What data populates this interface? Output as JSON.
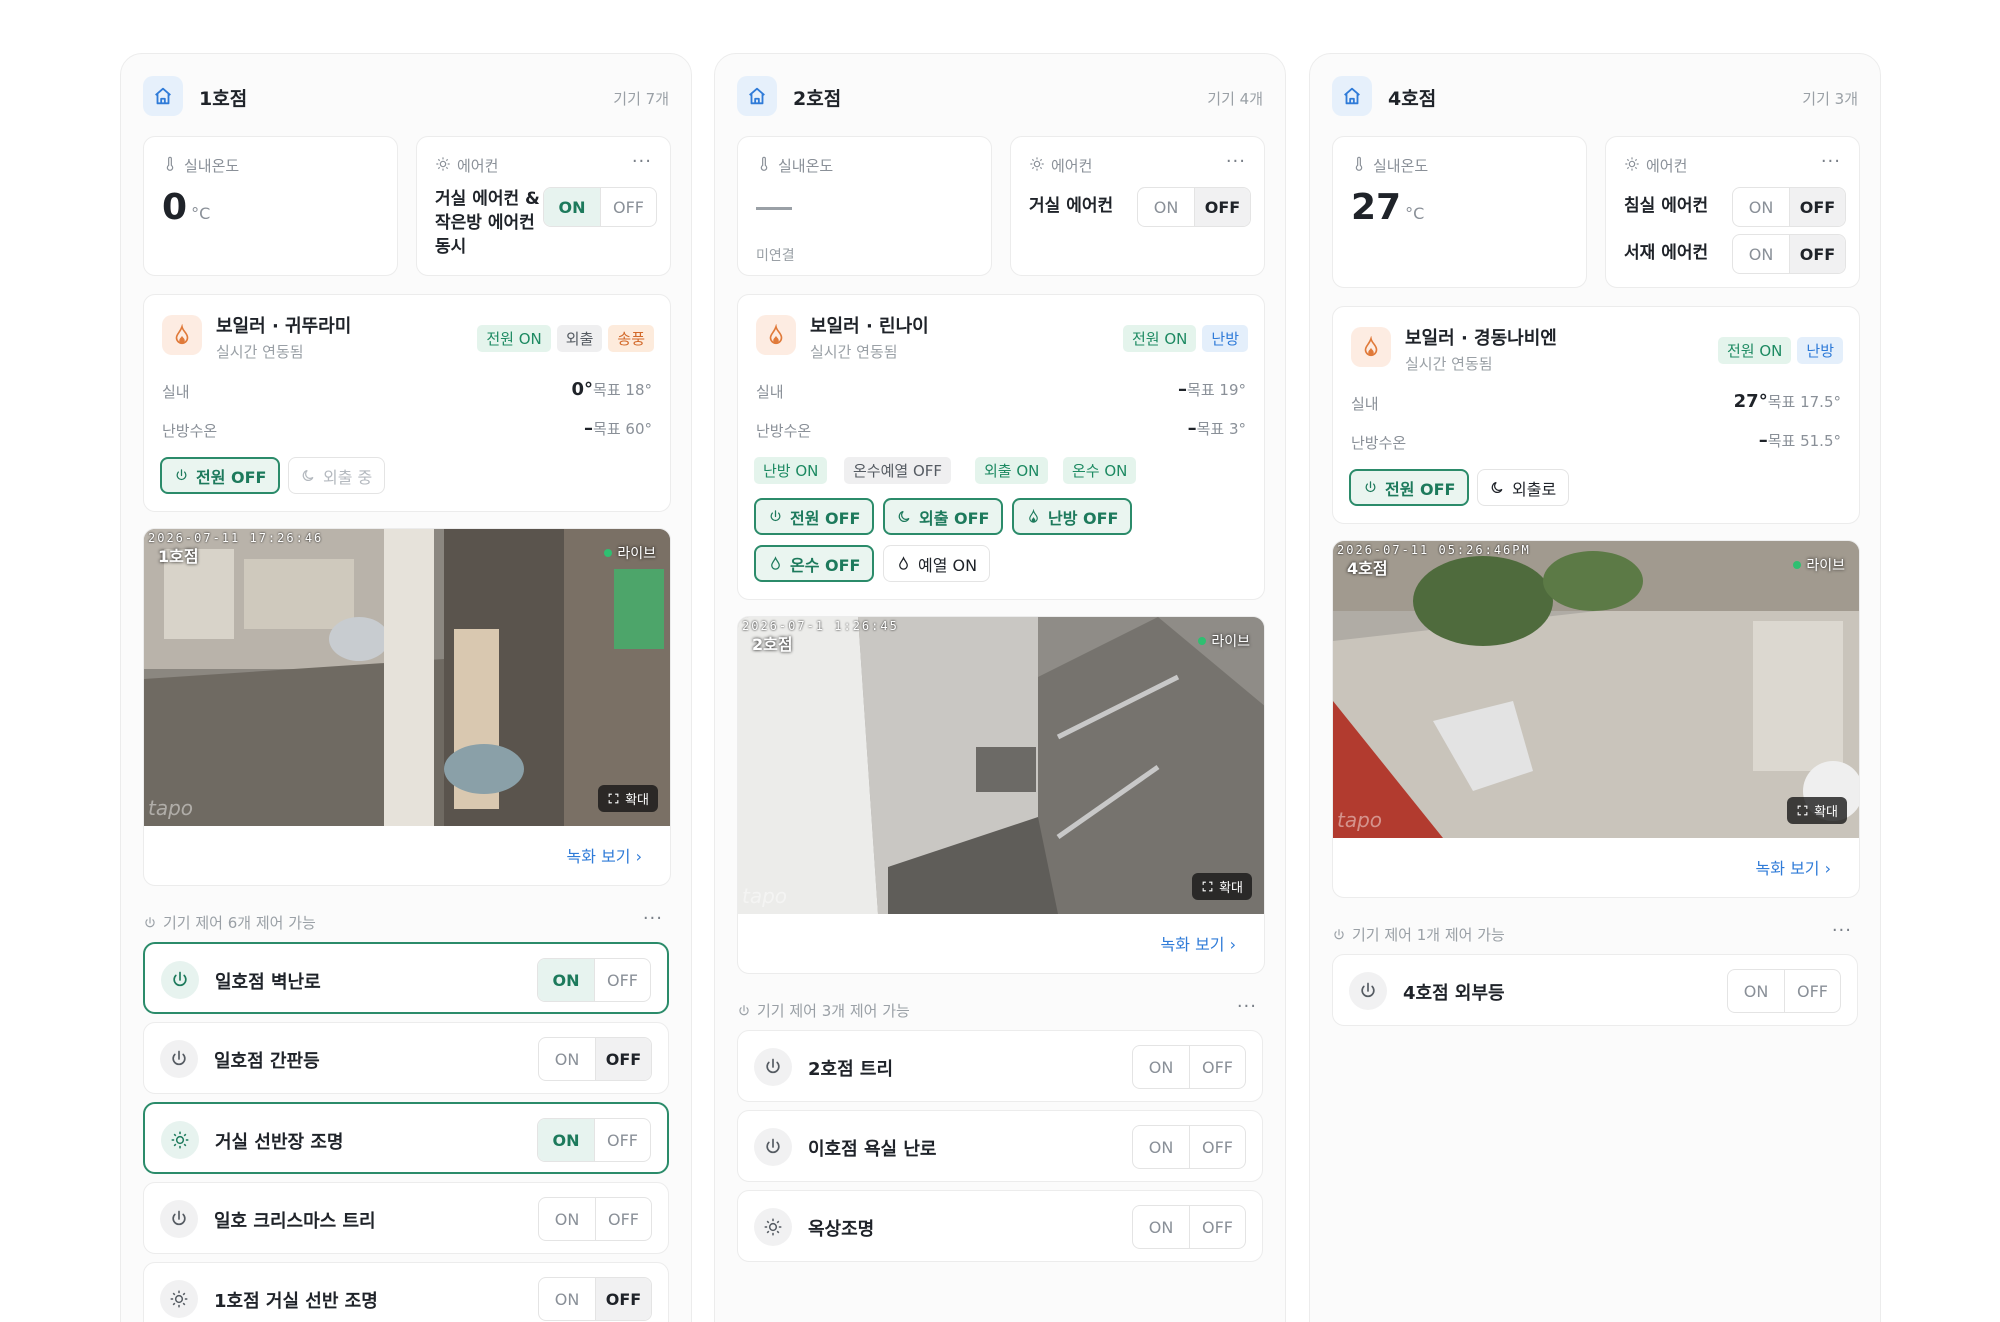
{
  "stores": [
    {
      "name": "1호점",
      "device_count": "기기 7개",
      "indoor": {
        "label": "실내온도",
        "value": "0",
        "unit": "°C"
      },
      "aircon": {
        "label": "에어컨",
        "units": [
          {
            "name": "거실 에어컨 &작은방 에어컨 동시",
            "state": "ON"
          }
        ]
      },
      "boiler": {
        "title": "보일러 · 귀뚜라미",
        "subtitle": "실시간 연동됨",
        "tags": [
          "전원 ON",
          "외출",
          "송풍"
        ],
        "indoor_label": "실내",
        "indoor_value": "0°",
        "indoor_target": "목표 18°",
        "water_label": "난방수온",
        "water_value": "–",
        "water_target": "목표 60°",
        "buttons": [
          "전원 OFF",
          "외출 중"
        ]
      },
      "camera": {
        "stamp": "2026-07-11  17:26:46",
        "name": "1호점",
        "live": "라이브",
        "zoom": "확대",
        "watermark": "tapo",
        "link": "녹화 보기"
      },
      "controls": {
        "header": "기기 제어 6개 제어 가능",
        "devices": [
          {
            "name": "일호점 벽난로",
            "icon": "power-icon",
            "state": "ON"
          },
          {
            "name": "일호점 간판등",
            "icon": "power-icon",
            "state": "OFF"
          },
          {
            "name": "거실 선반장 조명",
            "icon": "sun-icon",
            "state": "ON"
          },
          {
            "name": "일호 크리스마스 트리",
            "icon": "power-icon",
            "state": ""
          },
          {
            "name": "1호점 거실 선반 조명",
            "icon": "sun-icon",
            "state": "OFF"
          }
        ]
      }
    },
    {
      "name": "2호점",
      "device_count": "기기 4개",
      "indoor": {
        "label": "실내온도",
        "value": "",
        "unit": "",
        "note": "미연결"
      },
      "aircon": {
        "label": "에어컨",
        "units": [
          {
            "name": "거실 에어컨",
            "state": "OFF"
          }
        ]
      },
      "boiler": {
        "title": "보일러 · 린나이",
        "subtitle": "실시간 연동됨",
        "tags": [
          "전원 ON",
          "난방"
        ],
        "indoor_label": "실내",
        "indoor_value": "–",
        "indoor_target": "목표 19°",
        "water_label": "난방수온",
        "water_value": "–",
        "water_target": "목표 3°",
        "status_tags": [
          "난방 ON",
          "온수예열 OFF",
          "외출 ON",
          "온수 ON"
        ],
        "buttons": [
          "전원 OFF",
          "외출 OFF",
          "난방 OFF",
          "온수 OFF",
          "예열 ON"
        ]
      },
      "camera": {
        "stamp": "2026-07-1  1:26:45",
        "name": "2호점",
        "live": "라이브",
        "zoom": "확대",
        "watermark": "tapo",
        "link": "녹화 보기"
      },
      "controls": {
        "header": "기기 제어 3개 제어 가능",
        "devices": [
          {
            "name": "2호점 트리",
            "icon": "power-icon",
            "state": ""
          },
          {
            "name": "이호점 욕실 난로",
            "icon": "power-icon",
            "state": ""
          },
          {
            "name": "옥상조명",
            "icon": "sun-icon",
            "state": ""
          }
        ]
      }
    },
    {
      "name": "4호점",
      "device_count": "기기 3개",
      "indoor": {
        "label": "실내온도",
        "value": "27",
        "unit": "°C"
      },
      "aircon": {
        "label": "에어컨",
        "units": [
          {
            "name": "침실 에어컨",
            "state": "OFF"
          },
          {
            "name": "서재 에어컨",
            "state": "OFF"
          }
        ]
      },
      "boiler": {
        "title": "보일러 · 경동나비엔",
        "subtitle": "실시간 연동됨",
        "tags": [
          "전원 ON",
          "난방"
        ],
        "indoor_label": "실내",
        "indoor_value": "27°",
        "indoor_target": "목표 17.5°",
        "water_label": "난방수온",
        "water_value": "–",
        "water_target": "목표 51.5°",
        "buttons": [
          "전원 OFF",
          "외출로"
        ]
      },
      "camera": {
        "stamp": "2026-07-11  05:26:46PM",
        "name": "4호점",
        "live": "라이브",
        "zoom": "확대",
        "watermark": "tapo",
        "link": "녹화 보기"
      },
      "controls": {
        "header": "기기 제어 1개 제어 가능",
        "devices": [
          {
            "name": "4호점 외부등",
            "icon": "power-icon",
            "state": ""
          }
        ]
      }
    }
  ],
  "toggle": {
    "on": "ON",
    "off": "OFF"
  },
  "colors": {
    "accent_green": "#2b8b6a",
    "link_blue": "#2f7bd8",
    "boiler_orange": "#e07a3a",
    "live_dot": "#2fbf71"
  }
}
